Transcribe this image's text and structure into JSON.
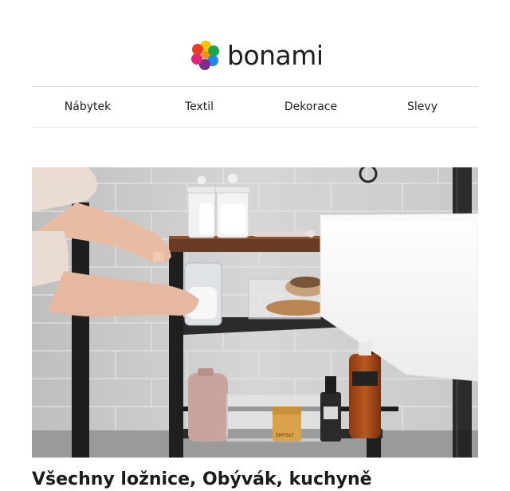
{
  "brand": {
    "name": "bonami"
  },
  "nav": {
    "items": [
      {
        "label": "Nábytek"
      },
      {
        "label": "Textil"
      },
      {
        "label": "Dekorace"
      },
      {
        "label": "Slevy"
      }
    ]
  },
  "hero": {
    "image_icon": "bathroom-shelf-photo",
    "label_jar": "SMYSLY"
  },
  "article": {
    "headline": "Všechny ložnice, Obývák, kuchyně"
  }
}
